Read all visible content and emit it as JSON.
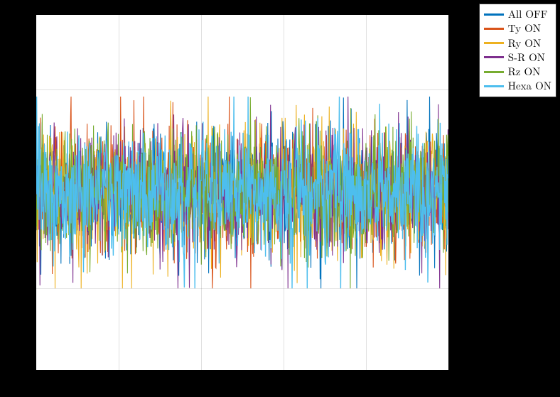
{
  "chart_data": {
    "type": "line",
    "title": "",
    "xlabel": "",
    "ylabel": "",
    "xlim": [
      0,
      1
    ],
    "ylim": [
      -1,
      1
    ],
    "grid": true,
    "legend_position": "outside-right-top",
    "x_grid_fractions": [
      0.0,
      0.2,
      0.4,
      0.6,
      0.8,
      1.0
    ],
    "y_grid_fractions": [
      0.21,
      0.77
    ],
    "series": [
      {
        "name": "All OFF",
        "color": "#0072bd",
        "noise_band": [
          -0.75,
          0.75
        ]
      },
      {
        "name": "Ty ON",
        "color": "#d95319",
        "noise_band": [
          -0.75,
          0.75
        ]
      },
      {
        "name": "Ry ON",
        "color": "#edb120",
        "noise_band": [
          -0.75,
          0.75
        ]
      },
      {
        "name": "S-R ON",
        "color": "#7e2f8e",
        "noise_band": [
          -0.75,
          0.75
        ]
      },
      {
        "name": "Rz ON",
        "color": "#77ac30",
        "noise_band": [
          -0.75,
          0.75
        ]
      },
      {
        "name": "Hexa ON",
        "color": "#4dbeee",
        "noise_band": [
          -0.75,
          0.75
        ]
      }
    ],
    "note": "Dense noise-like time-domain traces for 6 on/off configurations; amplitudes roughly symmetric about zero with occasional spikes; individual sample values not resolvable from image."
  },
  "legend": {
    "items": [
      {
        "label": "All OFF",
        "color": "#0072bd"
      },
      {
        "label": "Ty ON",
        "color": "#d95319"
      },
      {
        "label": "Ry ON",
        "color": "#edb120"
      },
      {
        "label": "S-R ON",
        "color": "#7e2f8e"
      },
      {
        "label": "Rz ON",
        "color": "#77ac30"
      },
      {
        "label": "Hexa ON",
        "color": "#4dbeee"
      }
    ]
  }
}
